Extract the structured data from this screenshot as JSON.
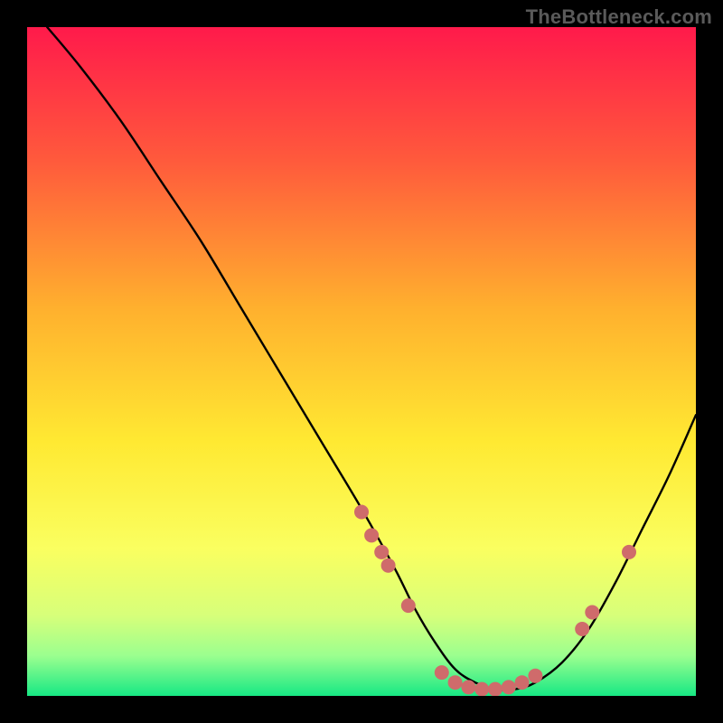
{
  "watermark": "TheBottleneck.com",
  "chart_data": {
    "type": "line",
    "title": "",
    "xlabel": "",
    "ylabel": "",
    "xlim": [
      0,
      100
    ],
    "ylim": [
      0,
      100
    ],
    "gradient_stops": [
      {
        "offset": 0.0,
        "color": "#ff1a4b"
      },
      {
        "offset": 0.2,
        "color": "#ff5a3c"
      },
      {
        "offset": 0.42,
        "color": "#ffb02e"
      },
      {
        "offset": 0.62,
        "color": "#ffe932"
      },
      {
        "offset": 0.78,
        "color": "#faff60"
      },
      {
        "offset": 0.88,
        "color": "#d7ff7a"
      },
      {
        "offset": 0.94,
        "color": "#9bff8f"
      },
      {
        "offset": 1.0,
        "color": "#17e884"
      }
    ],
    "series": [
      {
        "name": "bottleneck-curve",
        "x": [
          3,
          8,
          14,
          20,
          26,
          32,
          38,
          44,
          50,
          55,
          58,
          61,
          64,
          67,
          70,
          73,
          76,
          80,
          84,
          88,
          92,
          96,
          100
        ],
        "y": [
          100,
          94,
          86,
          77,
          68,
          58,
          48,
          38,
          28,
          19,
          13,
          8,
          4,
          2,
          1,
          1,
          2,
          5,
          10,
          17,
          25,
          33,
          42
        ]
      }
    ],
    "markers": [
      {
        "x": 50.0,
        "y": 27.5
      },
      {
        "x": 51.5,
        "y": 24.0
      },
      {
        "x": 53.0,
        "y": 21.5
      },
      {
        "x": 54.0,
        "y": 19.5
      },
      {
        "x": 57.0,
        "y": 13.5
      },
      {
        "x": 62.0,
        "y": 3.5
      },
      {
        "x": 64.0,
        "y": 2.0
      },
      {
        "x": 66.0,
        "y": 1.3
      },
      {
        "x": 68.0,
        "y": 1.0
      },
      {
        "x": 70.0,
        "y": 1.0
      },
      {
        "x": 72.0,
        "y": 1.3
      },
      {
        "x": 74.0,
        "y": 2.0
      },
      {
        "x": 76.0,
        "y": 3.0
      },
      {
        "x": 83.0,
        "y": 10.0
      },
      {
        "x": 84.5,
        "y": 12.5
      },
      {
        "x": 90.0,
        "y": 21.5
      }
    ],
    "marker_style": {
      "fill": "#cf6b6b",
      "r": 8
    }
  }
}
